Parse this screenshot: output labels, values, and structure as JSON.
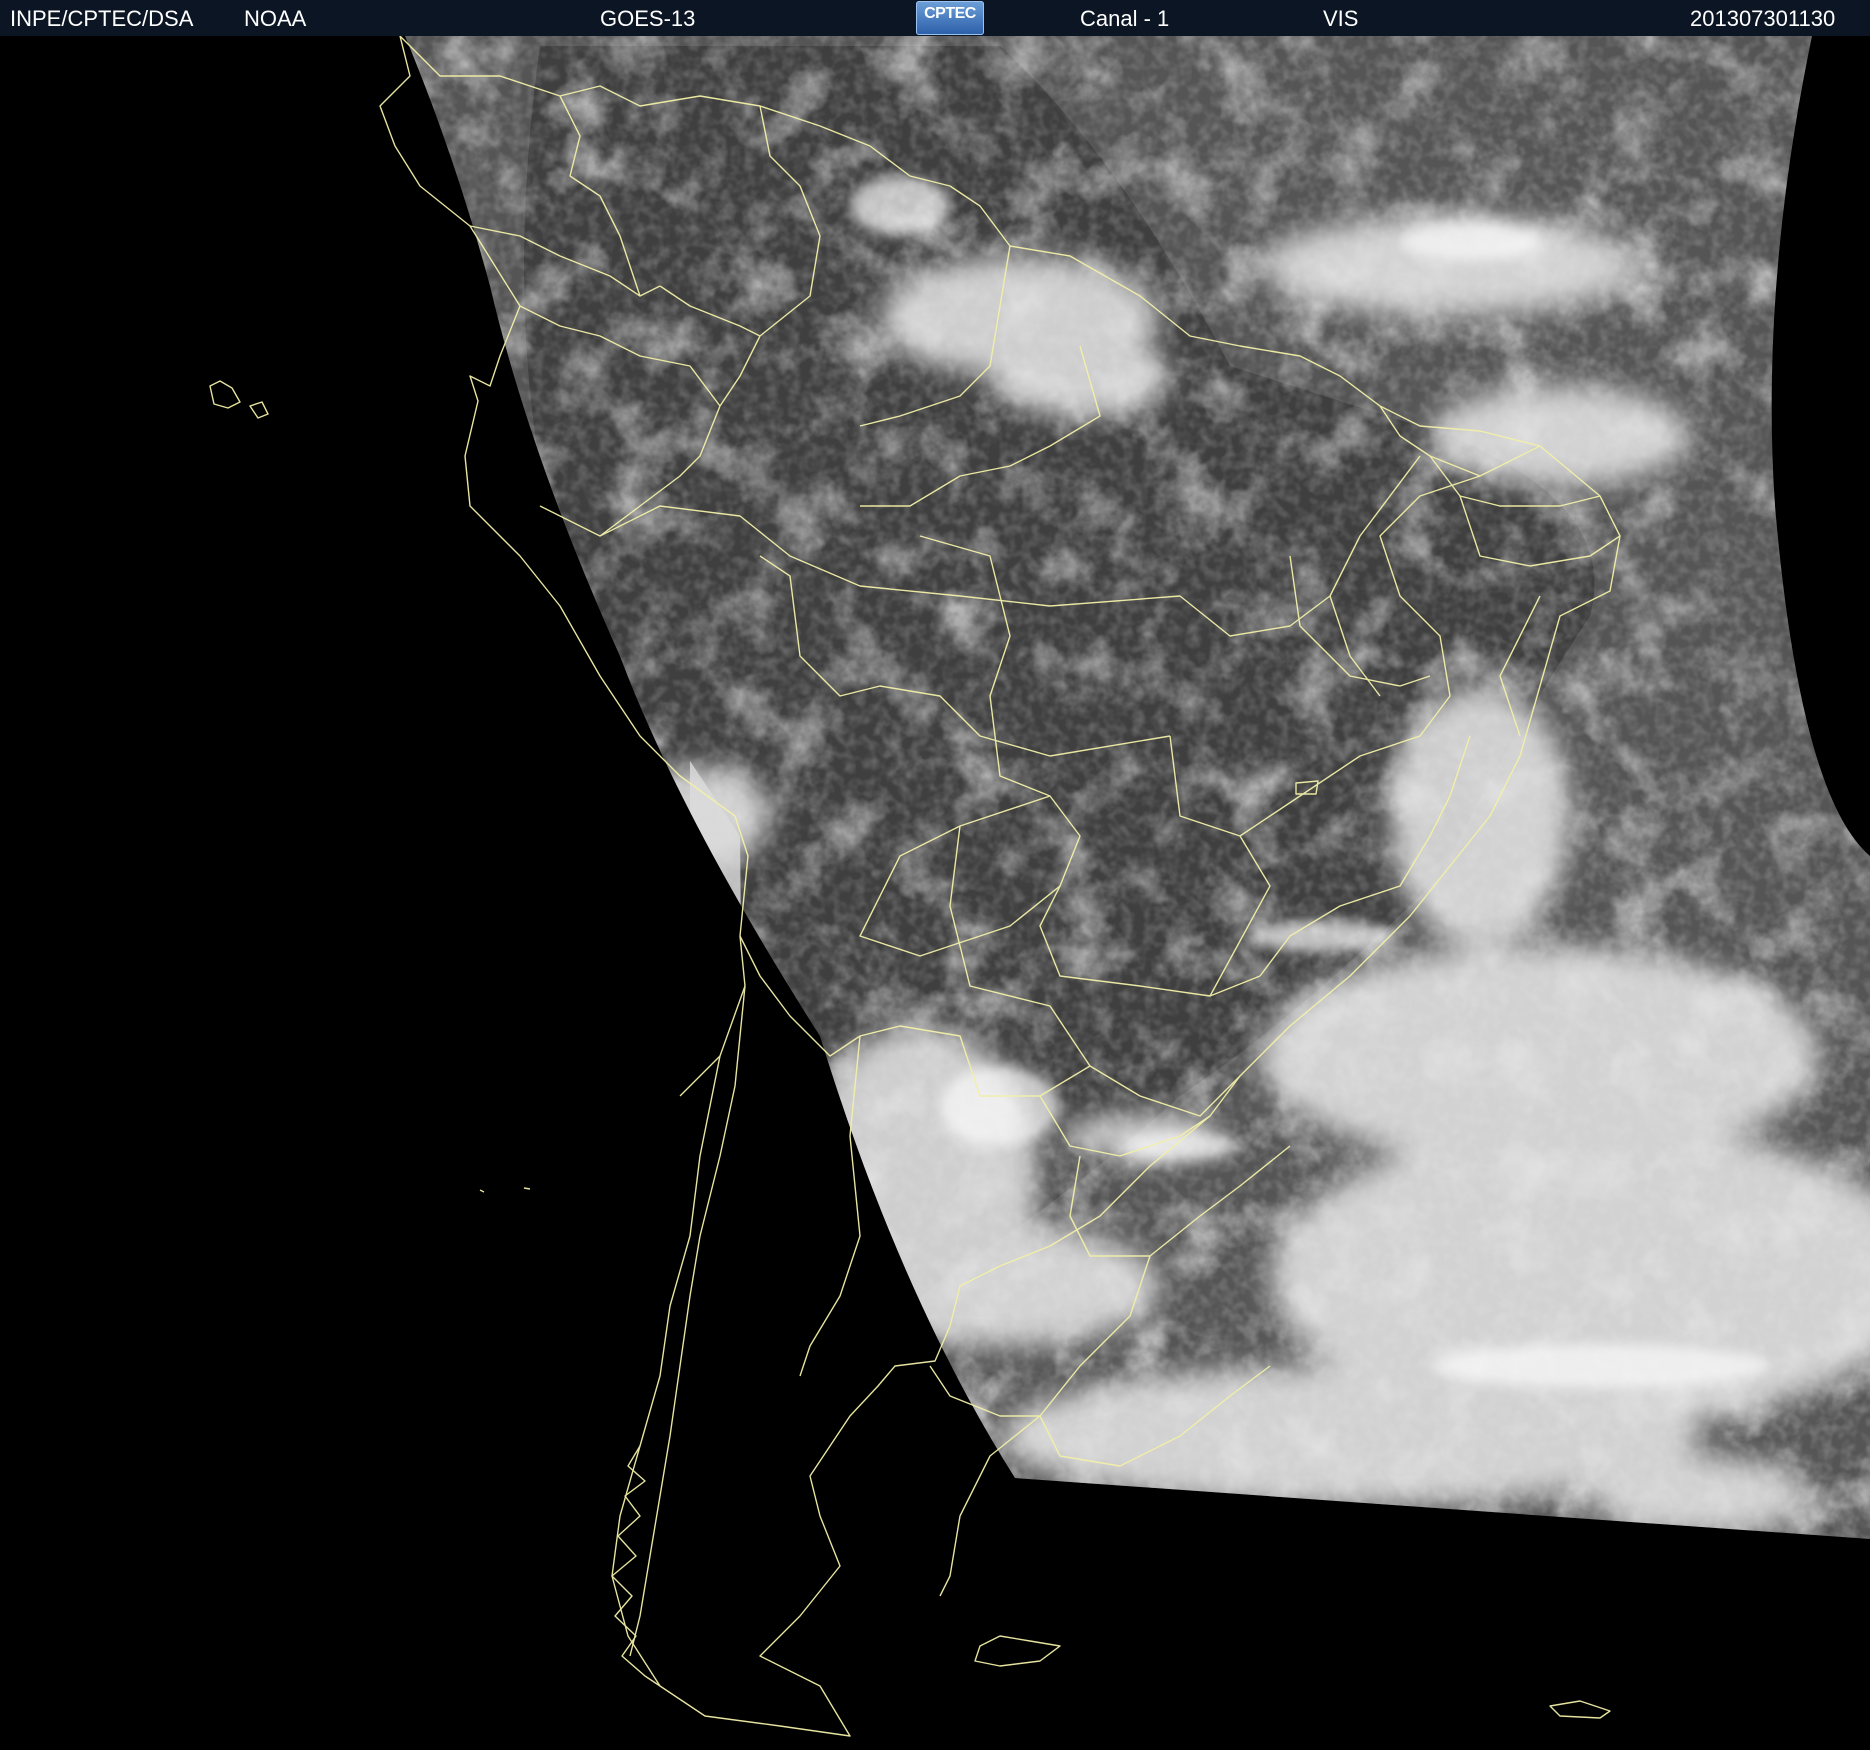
{
  "header": {
    "institution": "INPE/CPTEC/DSA",
    "agency": "NOAA",
    "satellite": "GOES-13",
    "logo": "CPTEC",
    "channel": "Canal - 1",
    "band": "VIS",
    "timestamp": "201307301130"
  },
  "colors": {
    "header_bg": "#0b1524",
    "ocean_bg": "#000000",
    "borders": "#f2f0a8"
  }
}
